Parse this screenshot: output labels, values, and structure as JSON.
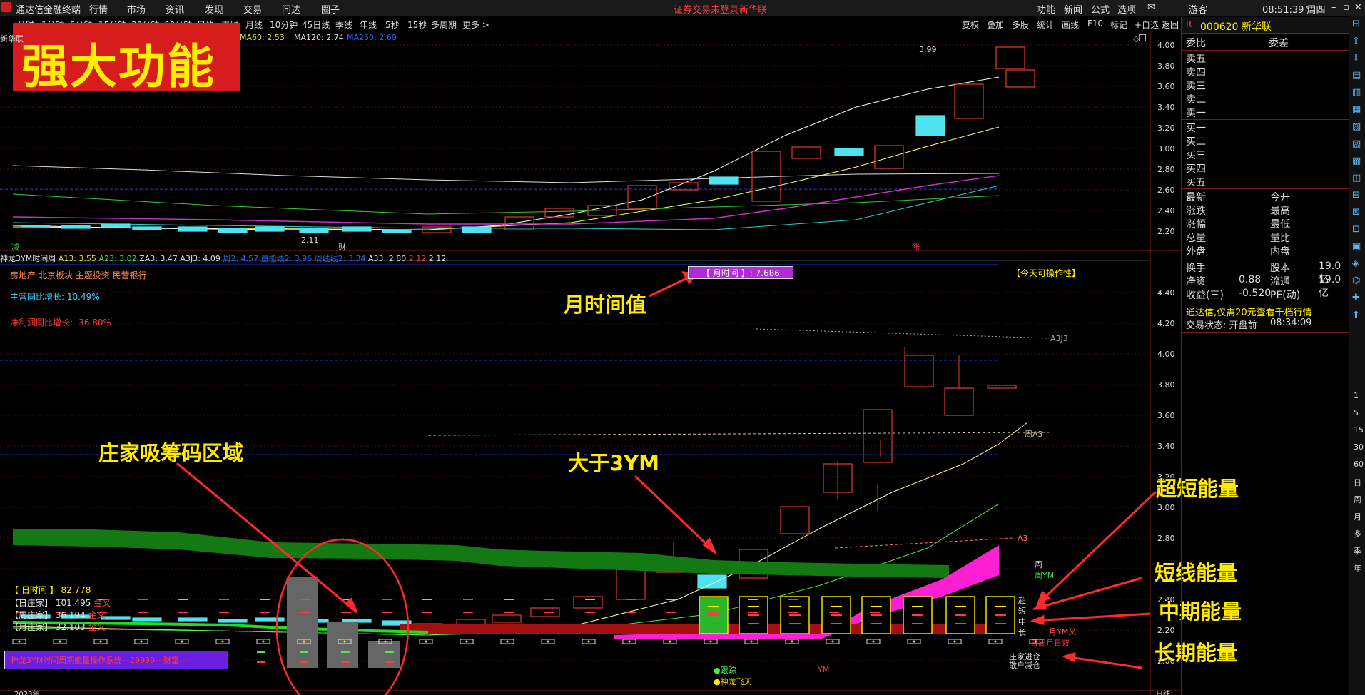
{
  "topbar": {
    "app_title": "通达信金融终端",
    "menus": [
      "行情",
      "市场",
      "资讯",
      "发现",
      "交易",
      "问达",
      "圈子"
    ],
    "login_notice": "证券交易未登录",
    "stock_name": "新华联",
    "right_menus": [
      "功能",
      "新闻",
      "公式",
      "选项"
    ],
    "user": "游客",
    "clock": "08:51:39 周四"
  },
  "periods": [
    "分时",
    "1分钟",
    "5分钟",
    "15分钟",
    "30分钟",
    "60分钟",
    "日线",
    "周线",
    "月线",
    "10分钟",
    "45日线",
    "季线",
    "年线",
    "5秒",
    "15秒",
    "多周期",
    "更多 >"
  ],
  "chart_tools": [
    "复权",
    "叠加",
    "多股",
    "统计",
    "画线",
    "F10",
    "标记",
    "+自选",
    "返回"
  ],
  "banner": {
    "text": "强大功能"
  },
  "upper_chart": {
    "legend_ma": [
      "MA60: 2.53",
      "MA120: 2.74",
      "MA250: 2.60"
    ],
    "price_labels": [
      "4.00",
      "3.80",
      "3.60",
      "3.40",
      "3.20",
      "3.00",
      "2.80",
      "2.60",
      "2.40",
      "2.20"
    ],
    "high_mark": "3.99",
    "low_mark": "2.11",
    "tag_left": "减",
    "tag_cai": "财",
    "tag_zhang": "涨"
  },
  "indicator_bar": {
    "name": "神龙3YM时间周",
    "values": [
      "A13: 3.55",
      "A23: 3.02",
      "ZA3: 3.47",
      "A3J3: 4.09",
      "周2: 4.57",
      "量能线2: 3.96",
      "周线线2: 3.34",
      "A33: 2.80",
      "2.12",
      "2.12"
    ]
  },
  "lower_chart": {
    "sector": "房地产 北京板块 主题投资 民营银行",
    "revenue_growth": "主营同比增长: 10.49%",
    "profit_growth": "净利润同比增长: -36.80%",
    "month_time_value": "【 月时间 】: 7.686",
    "today_tag": "【今天可操作性】",
    "price_labels": [
      "4.40",
      "4.20",
      "4.00",
      "3.80",
      "3.60",
      "3.40",
      "3.20",
      "3.00",
      "2.80",
      "2.60",
      "2.40",
      "2.20",
      "2.00"
    ],
    "line_labels": [
      "A3J3",
      "周A3",
      "A3",
      "周",
      "周YM",
      "超",
      "短",
      "中",
      "长",
      "月YM叉",
      "日周月日双",
      "庄家进仓",
      "散户减仓"
    ],
    "day_time": "【 日时间 】 82.778",
    "daily_dealer": "【日庄家】 101.495",
    "weekly_dealer": "【周庄家】 36.194",
    "monthly_dealer": "【月庄家】 32.103",
    "cross_tags": [
      "金叉",
      "金叉",
      "金叉"
    ],
    "system_banner": "神龙3YM时间周期能量操作系统---29999---财富---",
    "bottom_tags": [
      "●跟踪",
      "●神龙飞天",
      "YM"
    ],
    "year_label": "2023年",
    "period_label": "日线"
  },
  "annotations": {
    "month_value": "月时间值",
    "accumulation": "庄家吸筹码区域",
    "above_3ym": "大于3YM",
    "ultra_short": "超短能量",
    "short": "短线能量",
    "mid": "中期能量",
    "long": "长期能量"
  },
  "quote_panel": {
    "code_title": "000620 新华联",
    "header_left": "委比",
    "header_right": "委差",
    "sells": [
      "卖五",
      "卖四",
      "卖三",
      "卖二",
      "卖一"
    ],
    "buys": [
      "买一",
      "买二",
      "买三",
      "买四",
      "买五"
    ],
    "stats_left": [
      "最新",
      "涨跌",
      "涨幅",
      "总量",
      "外盘"
    ],
    "stats_right": [
      "今开",
      "最高",
      "最低",
      "量比",
      "内盘"
    ],
    "turnover_label": "换手",
    "share_cap_label": "股本",
    "share_cap_value": "19.0亿",
    "nav_label": "净资",
    "nav_value": "0.88",
    "float_label": "流通",
    "float_value": "19.0亿",
    "eps_label": "收益(三)",
    "eps_value": "-0.520",
    "pe_label": "PE(动)",
    "promo": "通达信,仅需20元查看千档行情",
    "trade_status": "交易状态: 开盘前",
    "trade_time": "08:34:09"
  },
  "side_tools": [
    "1",
    "5",
    "15",
    "30",
    "60",
    "日",
    "周",
    "月",
    "多",
    "季",
    "年"
  ],
  "colors": {
    "accent_red": "#d61c1c",
    "banner_text": "#ffee00",
    "annotation": "#ffeb00",
    "candle_up": "#e23b2e",
    "candle_down": "#4fe3f0",
    "green_band": "#1a7a1a",
    "magenta": "#ff1fd2"
  }
}
